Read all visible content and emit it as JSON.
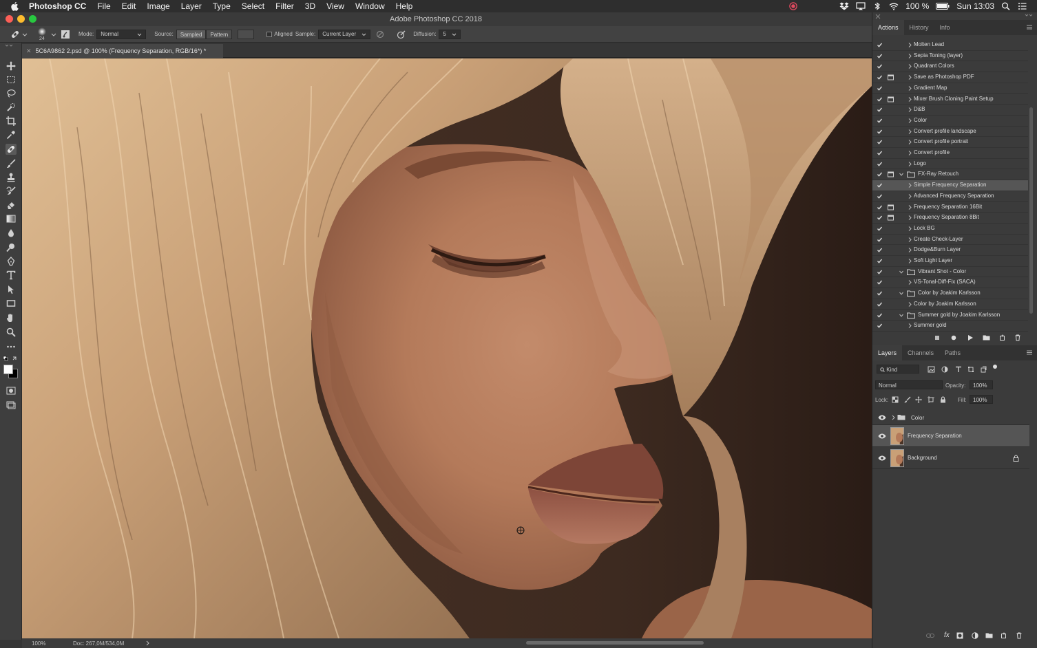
{
  "menubar": {
    "app_name": "Photoshop CC",
    "items": [
      "File",
      "Edit",
      "Image",
      "Layer",
      "Type",
      "Select",
      "Filter",
      "3D",
      "View",
      "Window",
      "Help"
    ],
    "battery": "100 %",
    "clock": "Sun 13:03"
  },
  "window": {
    "title": "Adobe Photoshop CC 2018"
  },
  "options": {
    "brush_size": "24",
    "mode_label": "Mode:",
    "mode_value": "Normal",
    "source_label": "Source:",
    "source_sampled": "Sampled",
    "source_pattern": "Pattern",
    "aligned_label": "Aligned",
    "sample_label": "Sample:",
    "sample_value": "Current Layer",
    "diffusion_label": "Diffusion:",
    "diffusion_value": "5"
  },
  "document": {
    "tab_title": "5C6A9862 2.psd @ 100% (Frequency Separation, RGB/16*) *",
    "zoom": "100%",
    "doc_size": "Doc: 267,0M/534,0M"
  },
  "actions_panel": {
    "tabs": [
      "Actions",
      "History",
      "Info"
    ],
    "rows": [
      {
        "label": "Molten Lead",
        "dialog": false,
        "level": 1,
        "folder": false,
        "expanded": false,
        "selected": false
      },
      {
        "label": "Sepia Toning (layer)",
        "dialog": false,
        "level": 1,
        "folder": false,
        "expanded": false,
        "selected": false
      },
      {
        "label": "Quadrant Colors",
        "dialog": false,
        "level": 1,
        "folder": false,
        "expanded": false,
        "selected": false
      },
      {
        "label": "Save as Photoshop PDF",
        "dialog": true,
        "level": 1,
        "folder": false,
        "expanded": false,
        "selected": false
      },
      {
        "label": "Gradient Map",
        "dialog": false,
        "level": 1,
        "folder": false,
        "expanded": false,
        "selected": false
      },
      {
        "label": "Mixer Brush Cloning Paint Setup",
        "dialog": true,
        "level": 1,
        "folder": false,
        "expanded": false,
        "selected": false
      },
      {
        "label": "D&B",
        "dialog": false,
        "level": 1,
        "folder": false,
        "expanded": false,
        "selected": false
      },
      {
        "label": "Color",
        "dialog": false,
        "level": 1,
        "folder": false,
        "expanded": false,
        "selected": false
      },
      {
        "label": "Convert profile landscape",
        "dialog": false,
        "level": 1,
        "folder": false,
        "expanded": false,
        "selected": false
      },
      {
        "label": "Convert profile portrait",
        "dialog": false,
        "level": 1,
        "folder": false,
        "expanded": false,
        "selected": false
      },
      {
        "label": "Convert profile",
        "dialog": false,
        "level": 1,
        "folder": false,
        "expanded": false,
        "selected": false
      },
      {
        "label": "Logo",
        "dialog": false,
        "level": 1,
        "folder": false,
        "expanded": false,
        "selected": false
      },
      {
        "label": "FX-Ray Retouch",
        "dialog": true,
        "level": 0,
        "folder": true,
        "expanded": true,
        "selected": false
      },
      {
        "label": "Simple Frequency Separation",
        "dialog": false,
        "level": 1,
        "folder": false,
        "expanded": false,
        "selected": true
      },
      {
        "label": "Advanced Frequency Separation",
        "dialog": false,
        "level": 1,
        "folder": false,
        "expanded": false,
        "selected": false
      },
      {
        "label": "Frequency Separation 16Bit",
        "dialog": true,
        "level": 1,
        "folder": false,
        "expanded": false,
        "selected": false
      },
      {
        "label": "Frequency Separation 8Bit",
        "dialog": true,
        "level": 1,
        "folder": false,
        "expanded": false,
        "selected": false
      },
      {
        "label": "Lock BG",
        "dialog": false,
        "level": 1,
        "folder": false,
        "expanded": false,
        "selected": false
      },
      {
        "label": "Create Check-Layer",
        "dialog": false,
        "level": 1,
        "folder": false,
        "expanded": false,
        "selected": false
      },
      {
        "label": "Dodge&Burn Layer",
        "dialog": false,
        "level": 1,
        "folder": false,
        "expanded": false,
        "selected": false
      },
      {
        "label": "Soft Light Layer",
        "dialog": false,
        "level": 1,
        "folder": false,
        "expanded": false,
        "selected": false
      },
      {
        "label": "Vibrant Shot - Color",
        "dialog": false,
        "level": 0,
        "folder": true,
        "expanded": true,
        "selected": false
      },
      {
        "label": "VS-Tonal-Diff-Fix (SACA)",
        "dialog": false,
        "level": 1,
        "folder": false,
        "expanded": false,
        "selected": false
      },
      {
        "label": "Color by Joakim Karlsson",
        "dialog": false,
        "level": 0,
        "folder": true,
        "expanded": true,
        "selected": false
      },
      {
        "label": "Color by Joakim Karlsson",
        "dialog": false,
        "level": 1,
        "folder": false,
        "expanded": false,
        "selected": false
      },
      {
        "label": "Summer gold by Joakim Karlsson",
        "dialog": false,
        "level": 0,
        "folder": true,
        "expanded": true,
        "selected": false
      },
      {
        "label": "Summer gold",
        "dialog": false,
        "level": 1,
        "folder": false,
        "expanded": false,
        "selected": false
      }
    ]
  },
  "layers_panel": {
    "tabs": [
      "Layers",
      "Channels",
      "Paths"
    ],
    "filter_kind": "Kind",
    "blend_mode": "Normal",
    "opacity_label": "Opacity:",
    "opacity_value": "100%",
    "lock_label": "Lock:",
    "fill_label": "Fill:",
    "fill_value": "100%",
    "layers": [
      {
        "name": "Color",
        "type": "group",
        "selected": false,
        "locked": false
      },
      {
        "name": "Frequency Separation",
        "type": "pixel",
        "selected": true,
        "locked": false
      },
      {
        "name": "Background",
        "type": "pixel",
        "selected": false,
        "locked": true
      }
    ]
  },
  "colors": {
    "accent_close": "#fc5f57",
    "accent_min": "#fdbc2e",
    "accent_max": "#28c840",
    "record_icon": "#e24a5f"
  }
}
